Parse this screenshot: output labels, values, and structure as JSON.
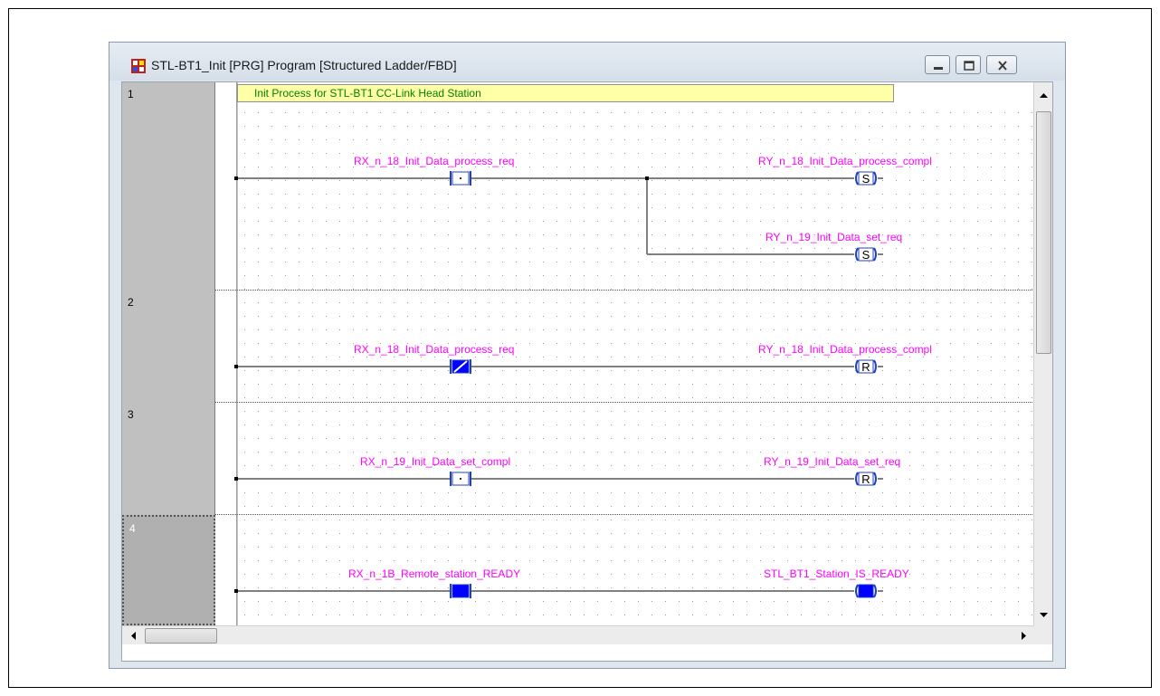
{
  "window": {
    "title": "STL-BT1_Init [PRG] Program [Structured Ladder/FBD]",
    "minimize_icon": "minimize-icon",
    "maximize_icon": "maximize-icon",
    "close_icon": "close-icon"
  },
  "comment": "Init Process for STL-BT1 CC-Link Head Station",
  "rungs": [
    {
      "number": "1",
      "contact_label": "RX_n_18_Init_Data_process_req",
      "coil_label": "RY_n_18_Init_Data_process_compl",
      "branch_coil_label": "RY_n_19_Init_Data_set_req"
    },
    {
      "number": "2",
      "contact_label": "RX_n_18_Init_Data_process_req",
      "coil_label": "RY_n_18_Init_Data_process_compl"
    },
    {
      "number": "3",
      "contact_label": "RX_n_19_Init_Data_set_compl",
      "coil_label": "RY_n_19_Init_Data_set_req"
    },
    {
      "number": "4",
      "contact_label": "RX_n_1B_Remote_station_READY",
      "coil_label": "STL_BT1_Station_IS_READY"
    }
  ],
  "colors": {
    "variable_label": "#ff00ff",
    "comment_text": "#008000",
    "comment_bg": "#ffffa8",
    "element_fill": "#0000ff"
  }
}
